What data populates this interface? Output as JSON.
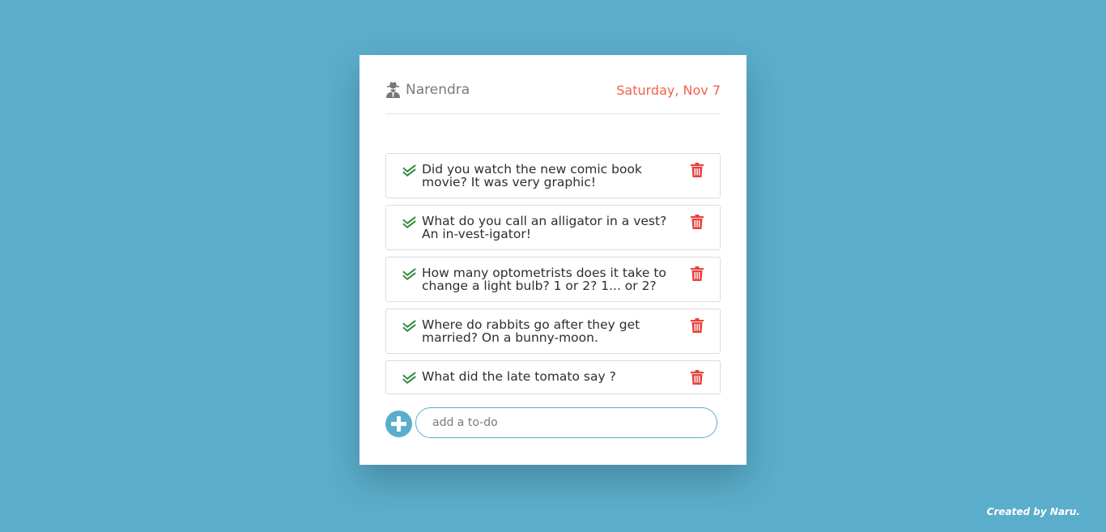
{
  "header": {
    "user_icon": "user-secret-icon",
    "username": "Narendra",
    "date": "Saturday, Nov 7"
  },
  "todos": [
    {
      "text": "Did you watch the new comic book movie? It was very graphic!",
      "done": true
    },
    {
      "text": "What do you call an alligator in a vest? An in-vest-igator!",
      "done": true
    },
    {
      "text": "How many optometrists does it take to change a light bulb? 1 or 2? 1... or 2?",
      "done": true
    },
    {
      "text": "Where do rabbits go after they get married? On a bunny-moon.",
      "done": true
    },
    {
      "text": "What did the late tomato say ?",
      "done": true
    }
  ],
  "add": {
    "placeholder": "add a to-do",
    "button_icon": "plus-circle-icon"
  },
  "footer": {
    "credit": "Created by Naru."
  },
  "colors": {
    "background": "#5aaecb",
    "date": "#f0634d",
    "check": "#2e8b3e",
    "trash": "#e8413c"
  }
}
